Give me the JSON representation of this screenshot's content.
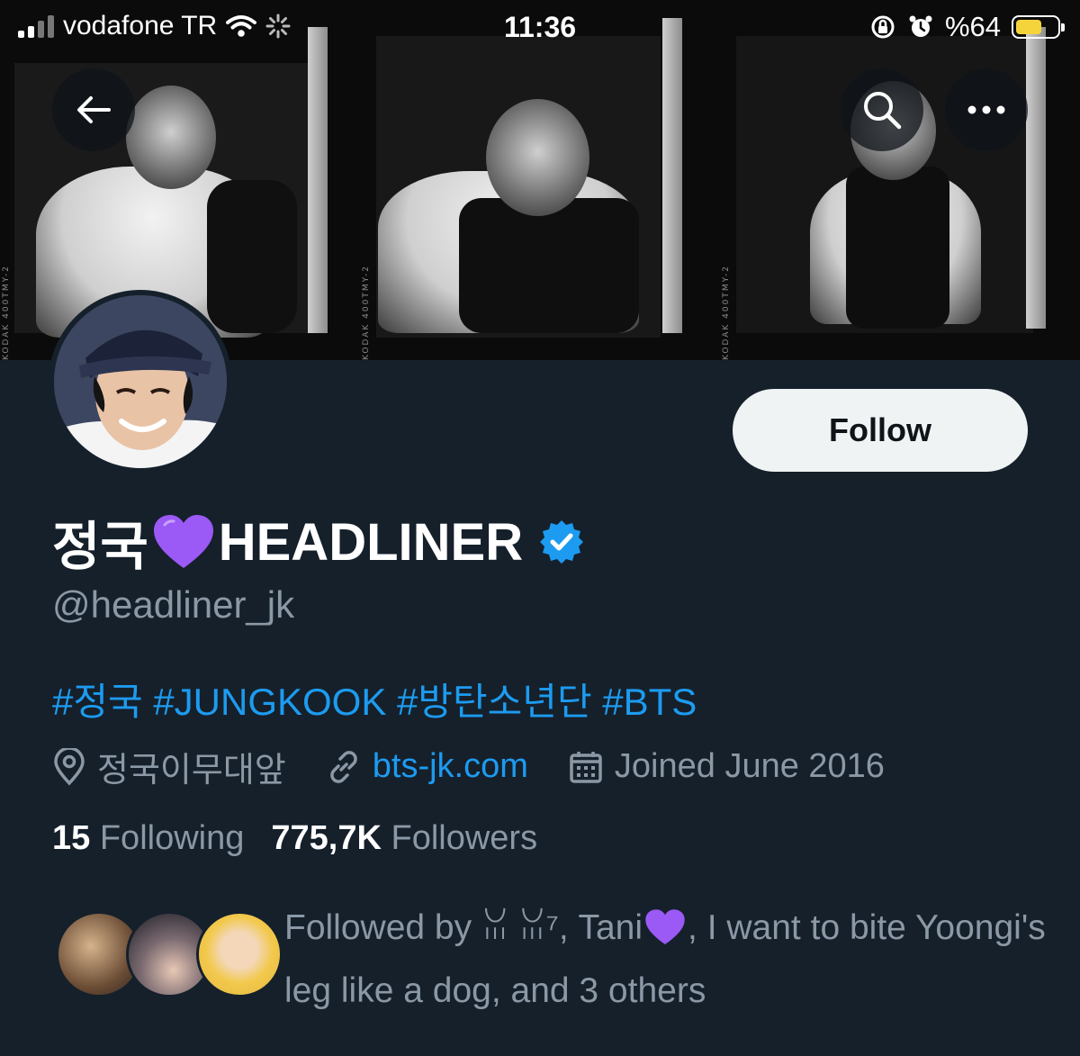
{
  "status_bar": {
    "carrier": "vodafone TR",
    "time": "11:36",
    "battery": "%64",
    "battery_level": 0.64
  },
  "banner": {
    "film_labels": [
      "KODAK 400TMY-2",
      "KODAK 400TMY-2",
      "KODAK 400TMY-2"
    ]
  },
  "header_buttons": {
    "back": "back-arrow-icon",
    "search": "search-icon",
    "more": "more-icon"
  },
  "profile": {
    "follow_label": "Follow",
    "display_name": "정국",
    "display_name_suffix": "HEADLINER",
    "handle": "@headliner_jk",
    "bio": "#정국 #JUNGKOOK #방탄소년단 #BTS",
    "location": "정국이무대앞",
    "website": "bts-jk.com",
    "joined": "Joined June 2016",
    "following_count": "15",
    "following_label": "Following",
    "followers_count": "775,7K",
    "followers_label": "Followers",
    "followed_by_prefix": "Followed by ",
    "followed_by_names": "ꈍ ꈍ⁷, Tani",
    "followed_by_rest": ", I want to bite Yoongi's leg like a dog, and 3 others"
  },
  "colors": {
    "background": "#15202b",
    "accent": "#1d9bf0",
    "muted": "#8b98a5",
    "verified": "#1d9bf0",
    "heart": "#9b59f5"
  }
}
